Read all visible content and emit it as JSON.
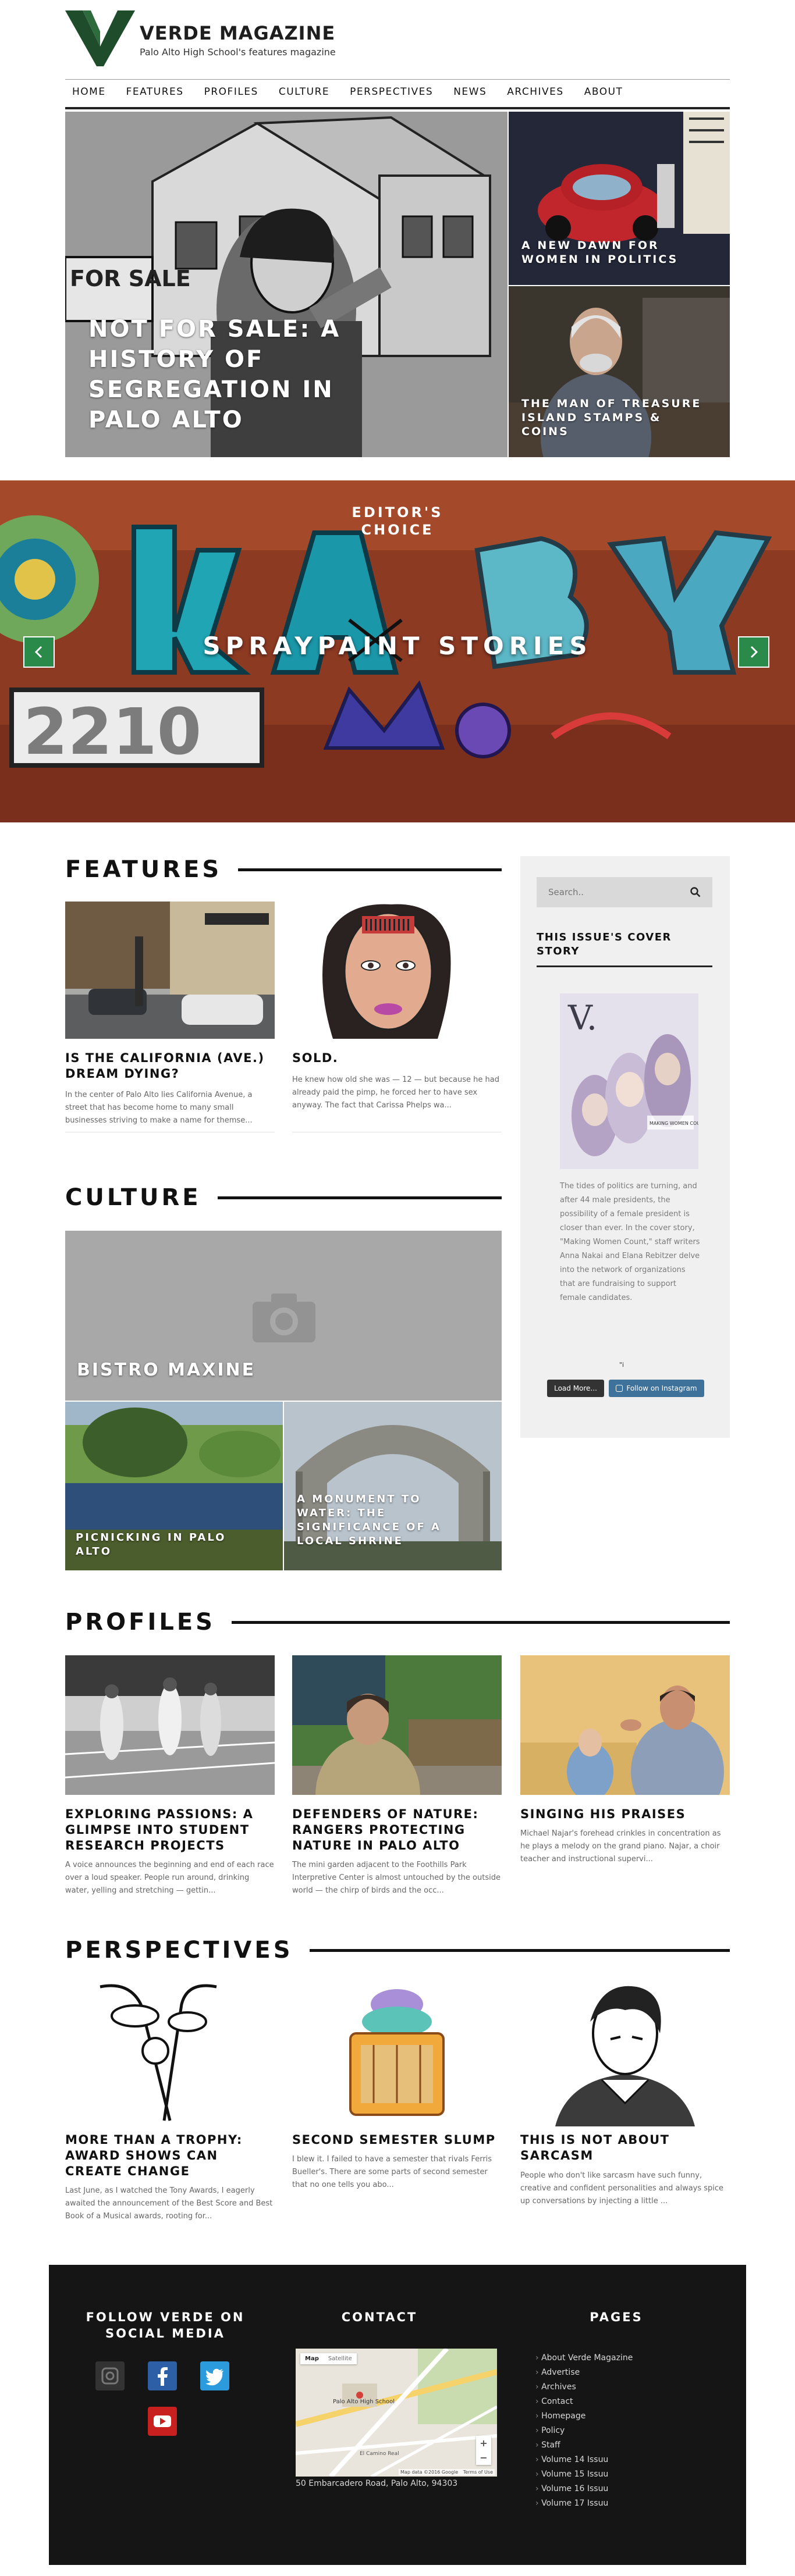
{
  "site": {
    "logo_letter": "V",
    "title": "VERDE MAGAZINE",
    "tagline": "Palo Alto High School's features magazine",
    "brand_color": "#1f4d2c"
  },
  "nav": [
    "HOME",
    "FEATURES",
    "PROFILES",
    "CULTURE",
    "PERSPECTIVES",
    "NEWS",
    "ARCHIVES",
    "ABOUT"
  ],
  "hero": {
    "main_title": "NOT FOR SALE: A HISTORY OF SEGREGATION IN PALO ALTO",
    "main_sign_text": "FOR SALE",
    "side_top_title": "A NEW DAWN FOR WOMEN IN POLITICS",
    "side_bottom_title": "THE MAN OF TREASURE ISLAND STAMPS & COINS"
  },
  "banner": {
    "kicker_line1": "EDITOR'S",
    "kicker_line2": "CHOICE",
    "title": "SPRAYPAINT STORIES",
    "prev_icon": "chevron-left-icon",
    "next_icon": "chevron-right-icon"
  },
  "features": {
    "heading": "FEATURES",
    "cards": [
      {
        "title": "IS THE CALIFORNIA (AVE.) DREAM DYING?",
        "excerpt": "In the center of Palo Alto lies California Avenue, a street that has become home to many small businesses striving to make a name for themse..."
      },
      {
        "title": "SOLD.",
        "excerpt": "He knew how old she was — 12 — but because he had already paid the pimp, he forced her to have sex anyway. The fact that Carissa Phelps wa..."
      }
    ]
  },
  "culture": {
    "heading": "CULTURE",
    "main_title": "BISTRO MAXINE",
    "tiles": [
      {
        "title": "PICNICKING IN PALO ALTO"
      },
      {
        "title": "A MONUMENT TO WATER: THE SIGNIFICANCE OF A LOCAL SHRINE"
      }
    ]
  },
  "sidebar": {
    "search_placeholder": "Search..",
    "search_icon": "search-icon",
    "cover_heading": "THIS ISSUE'S COVER STORY",
    "cover_letter": "V.",
    "cover_badge": "MAKING WOMEN COUNT",
    "cover_text": "The tides of politics are turning, and after 44 male presidents, the possibility of a female president is closer than ever. In the cover story, \"Making Women Count,\" staff writers Anna Nakai and Elana Rebitzer delve into the network of organizations that are fundraising to support female candidates.",
    "small_mark": "\"i",
    "load_more": "Load More...",
    "follow_instagram": "Follow on Instagram"
  },
  "profiles": {
    "heading": "PROFILES",
    "cards": [
      {
        "title": "EXPLORING PASSIONS: A GLIMPSE INTO STUDENT RESEARCH PROJECTS",
        "excerpt": "A voice announces the beginning and end of each race over a loud speaker. People run around, drinking water, yelling and stretching — gettin..."
      },
      {
        "title": "DEFENDERS OF NATURE: RANGERS PROTECTING NATURE IN PALO ALTO",
        "excerpt": "The mini garden adjacent to the Foothills Park Interpretive Center is almost untouched by the outside world — the chirp of birds and the occ..."
      },
      {
        "title": "SINGING HIS PRAISES",
        "excerpt": "Michael Najar's forehead crinkles in concentration as he plays a melody on the grand piano. Najar, a choir teacher and instructional supervi..."
      }
    ]
  },
  "perspectives": {
    "heading": "PERSPECTIVES",
    "cards": [
      {
        "title": "MORE THAN A TROPHY: AWARD SHOWS CAN CREATE CHANGE",
        "excerpt": "Last June, as I watched the Tony Awards, I eagerly awaited the announcement of the Best Score and Best Book of a Musical awards, rooting for..."
      },
      {
        "title": "SECOND SEMESTER SLUMP",
        "excerpt": "I blew it. I failed to have a semester that rivals Ferris Bueller's. There are some parts of second semester that no one tells you abo..."
      },
      {
        "title": "THIS IS NOT ABOUT SARCASM",
        "excerpt": "People who don't like sarcasm have such funny, creative and confident personalities and always spice up conversations by injecting a little ..."
      }
    ]
  },
  "footer": {
    "social_heading_line1": "FOLLOW VERDE ON",
    "social_heading_line2": "SOCIAL MEDIA",
    "social_icons": [
      "instagram-icon",
      "facebook-icon",
      "twitter-icon",
      "youtube-icon"
    ],
    "contact_heading": "CONTACT",
    "map": {
      "tab_map": "Map",
      "tab_satellite": "Satellite",
      "place_label": "Palo Alto High School",
      "attribution": "Map data ©2016 Google",
      "terms": "Terms of Use",
      "street_label": "El Camino Real",
      "zoom_in": "+",
      "zoom_out": "−"
    },
    "address": "50 Embarcadero Road, Palo Alto, 94303",
    "pages_heading": "PAGES",
    "pages": [
      "About Verde Magazine",
      "Advertise",
      "Archives",
      "Contact",
      "Homepage",
      "Policy",
      "Staff",
      "Volume 14 Issuu",
      "Volume 15 Issuu",
      "Volume 16 Issuu",
      "Volume 17 Issuu"
    ]
  },
  "colors": {
    "instagram": "#333333",
    "facebook": "#2d5fa7",
    "twitter": "#2b9bde",
    "youtube": "#c81f1f",
    "instagram_button": "#3f729b",
    "load_button": "#333333"
  }
}
